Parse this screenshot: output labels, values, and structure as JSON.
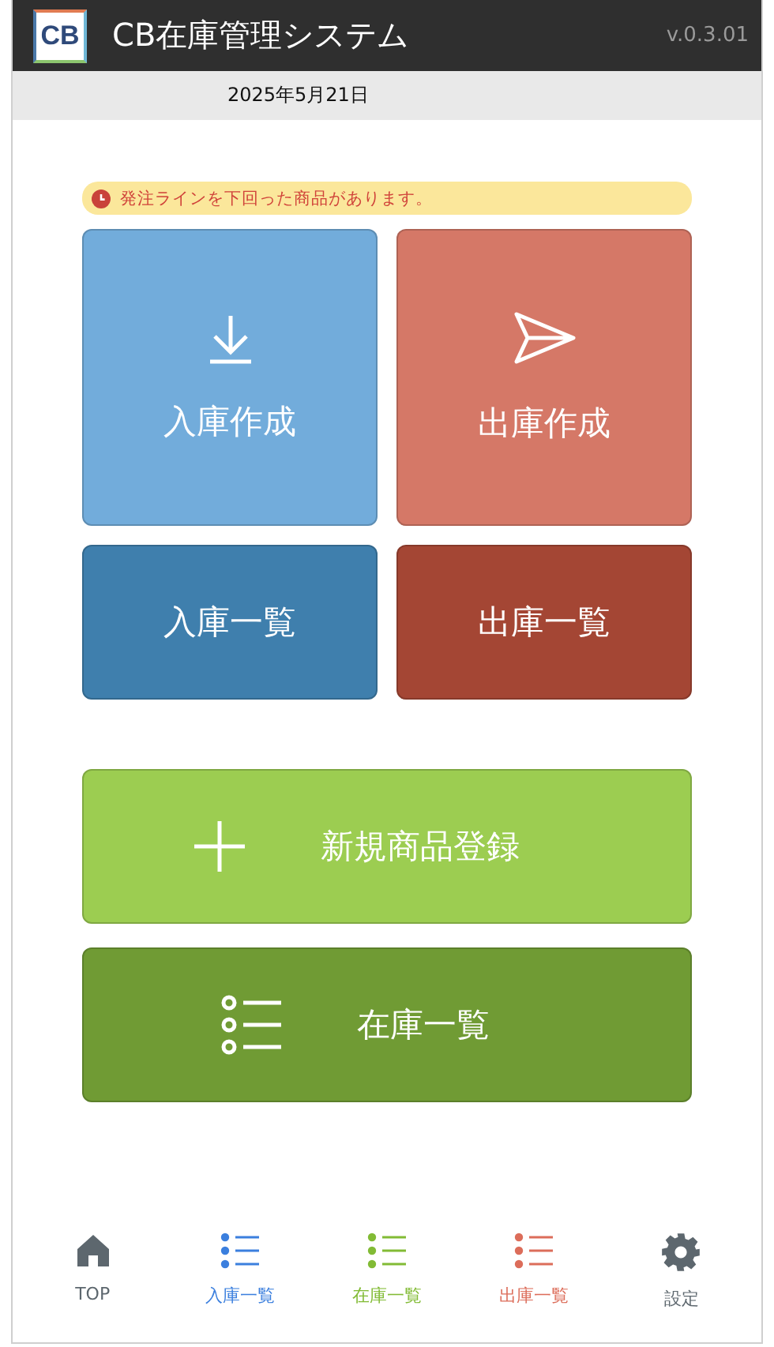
{
  "header": {
    "logo": "CB",
    "title": "CB在庫管理システム",
    "version": "v.0.3.01"
  },
  "date": "2025年5月21日",
  "alert": {
    "text": "発注ラインを下回った商品があります。"
  },
  "tiles": [
    {
      "label": "入庫作成",
      "kind": "download",
      "color": "#72acdb"
    },
    {
      "label": "出庫作成",
      "kind": "send",
      "color": "#d57867"
    },
    {
      "label": "入庫一覧",
      "kind": "plain",
      "color": "#3f7fad"
    },
    {
      "label": "出庫一覧",
      "kind": "plain",
      "color": "#a44634"
    }
  ],
  "wide_buttons": [
    {
      "label": "新規商品登録",
      "kind": "plus",
      "color": "#9ccd51"
    },
    {
      "label": "在庫一覧",
      "kind": "list",
      "color": "#709b34"
    }
  ],
  "nav": [
    {
      "label": "TOP",
      "kind": "home",
      "color": "#5d676e"
    },
    {
      "label": "入庫一覧",
      "kind": "list",
      "color": "#3b7fde"
    },
    {
      "label": "在庫一覧",
      "kind": "list",
      "color": "#82bb35"
    },
    {
      "label": "出庫一覧",
      "kind": "list",
      "color": "#dc6d5a"
    },
    {
      "label": "設定",
      "kind": "gear",
      "color": "#5d676e"
    }
  ]
}
